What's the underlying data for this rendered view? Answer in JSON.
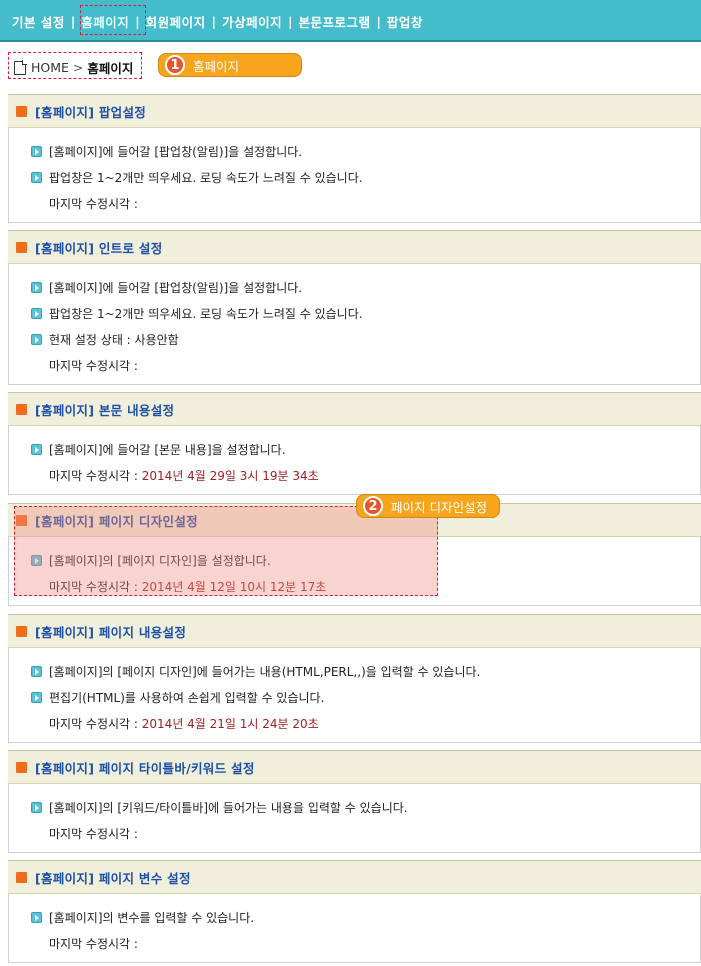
{
  "topnav": {
    "items": [
      "기본 설정",
      "홈페이지",
      "회원페이지",
      "가상페이지",
      "본문프로그램",
      "팝업창"
    ],
    "separator": "|"
  },
  "breadcrumb": {
    "home": "HOME",
    "arrow": ">",
    "current": "홈페이지"
  },
  "callouts": [
    {
      "num": "1",
      "label": "홈페이지"
    },
    {
      "num": "2",
      "label": "페이지 디자인설정"
    }
  ],
  "sections": [
    {
      "title": "[홈페이지] 팝업설정",
      "lines": [
        "[홈페이지]에 들어갈 [팝업창(알림)]을 설정합니다.",
        "팝업창은 1~2개만 띄우세요. 로딩 속도가 느려질 수 있습니다."
      ],
      "last_label": "마지막 수정시각 :",
      "last_value": ""
    },
    {
      "title": "[홈페이지] 인트로 설정",
      "lines": [
        "[홈페이지]에 들어갈 [팝업창(알림)]을 설정합니다.",
        "팝업창은 1~2개만 띄우세요. 로딩 속도가 느려질 수 있습니다.",
        "현재 설정 상태 : 사용안함"
      ],
      "last_label": "마지막 수정시각 :",
      "last_value": ""
    },
    {
      "title": "[홈페이지] 본문 내용설정",
      "lines": [
        "[홈페이지]에 들어갈 [본문 내용]을 설정합니다."
      ],
      "last_label": "마지막 수정시각 :",
      "last_value": "2014년 4월 29일 3시 19분 34초"
    },
    {
      "title": "[홈페이지] 페이지 디자인설정",
      "lines": [
        "[홈페이지]의 [페이지 디자인]을 설정합니다."
      ],
      "last_label": "마지막 수정시각 :",
      "last_value": "2014년 4월 12일 10시 12분 17초"
    },
    {
      "title": "[홈페이지] 페이지 내용설정",
      "lines": [
        "[홈페이지]의 [페이지 디자인]에 들어가는 내용(HTML,PERL,,)을 입력할 수 있습니다.",
        "편집기(HTML)를 사용하여 손쉽게 입력할 수 있습니다."
      ],
      "last_label": "마지막 수정시각 :",
      "last_value": "2014년 4월 21일 1시 24분 20초"
    },
    {
      "title": "[홈페이지] 페이지 타이틀바/키워드 설정",
      "lines": [
        "[홈페이지]의 [키워드/타이틀바]에 들어가는 내용을 입력할 수 있습니다."
      ],
      "last_label": "마지막 수정시각 :",
      "last_value": ""
    },
    {
      "title": "[홈페이지] 페이지 변수 설정",
      "lines": [
        "[홈페이지]의 변수를 입력할 수 있습니다."
      ],
      "last_label": "마지막 수정시각 :",
      "last_value": ""
    }
  ],
  "colors": {
    "topbar": "#45bccb",
    "section_header": "#f0efdb",
    "title_blue": "#1c4fa8",
    "square_orange": "#ef6b1e",
    "timestamp_red": "#a32020",
    "callout_orange": "#f6a51d",
    "highlight_red": "#d6203a"
  },
  "icons": {
    "breadcrumb": "document-icon",
    "section": "orange-square-icon",
    "bullet": "arrow-bullet-icon"
  }
}
